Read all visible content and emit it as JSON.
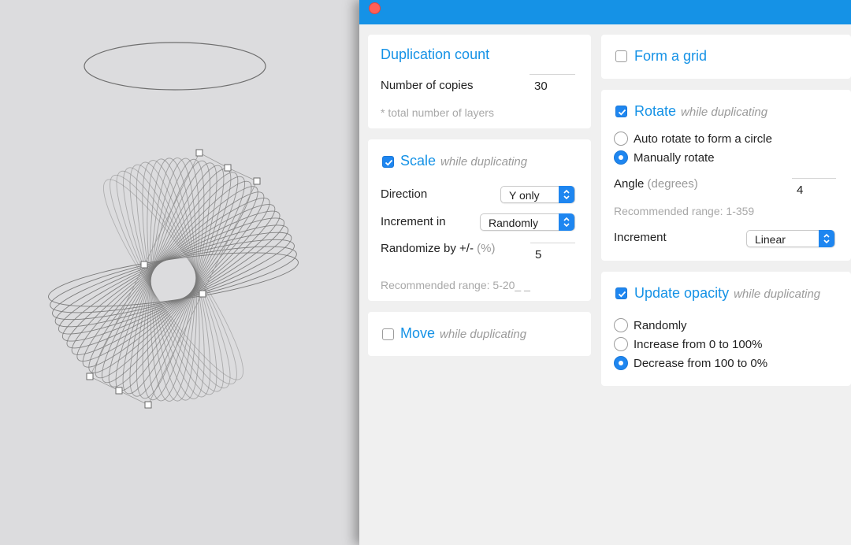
{
  "window": {
    "close_icon": "close-icon",
    "accent_color": "#1592e6",
    "close_color": "#ff5f57"
  },
  "duplication": {
    "title": "Duplication count",
    "copies_label": "Number of copies",
    "copies_value": "30",
    "note": "* total number of layers"
  },
  "scale": {
    "checked": true,
    "title": "Scale",
    "subtitle": "while duplicating",
    "direction_label": "Direction",
    "direction_value": "Y only",
    "increment_label": "Increment in",
    "increment_value": "Randomly",
    "randomize_label": "Randomize by +/-",
    "randomize_unit": "(%)",
    "randomize_value": "5",
    "range_hint": "Recommended range: 5-20_ _"
  },
  "move": {
    "checked": false,
    "title": "Move",
    "subtitle": "while duplicating"
  },
  "grid": {
    "checked": false,
    "title": "Form a grid"
  },
  "rotate": {
    "checked": true,
    "title": "Rotate",
    "subtitle": "while duplicating",
    "options": [
      {
        "label": "Auto rotate to form a circle",
        "selected": false
      },
      {
        "label": "Manually rotate",
        "selected": true
      }
    ],
    "angle_label": "Angle",
    "angle_unit": "(degrees)",
    "angle_value": "4",
    "range_hint": "Recommended range: 1-359",
    "increment_label": "Increment",
    "increment_value": "Linear"
  },
  "opacity": {
    "checked": true,
    "title": "Update opacity",
    "subtitle": "while duplicating",
    "options": [
      {
        "label": "Randomly",
        "selected": false
      },
      {
        "label": "Increase from 0 to 100%",
        "selected": false
      },
      {
        "label": "Decrease from 100 to 0%",
        "selected": true
      }
    ]
  },
  "canvas": {
    "ellipse_copies": 30,
    "stroke_color": "#7a7a7a"
  }
}
